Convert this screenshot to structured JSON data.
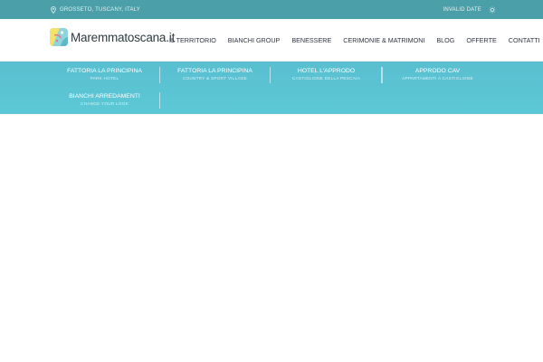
{
  "topbar": {
    "location": "GROSSETO, TUSCANY, ITALY",
    "date": "INVALID DATE"
  },
  "header": {
    "logo_text": "Maremmatoscana.it",
    "nav": [
      {
        "label": "IL TERRITORIO"
      },
      {
        "label": "BIANCHI GROUP"
      },
      {
        "label": "BENESSERE"
      },
      {
        "label": "CERIMONIE & MATRIMONI"
      },
      {
        "label": "BLOG"
      },
      {
        "label": "OFFERTE"
      },
      {
        "label": "CONTATTI"
      }
    ]
  },
  "mega_menu": {
    "items": [
      {
        "title": "FATTORIA LA PRINCIPINA",
        "subtitle": "PARK HOTEL"
      },
      {
        "title": "FATTORIA LA PRINCIPINA",
        "subtitle": "COUNTRY & SPORT VILLAGE"
      },
      {
        "title": "HOTEL L'APPRODO",
        "subtitle": "CASTIGLIONE DELLA PESCAIA"
      },
      {
        "title": "APPRODO CAV",
        "subtitle": "APPARTAMENTI A CASTIGLIONE"
      },
      {
        "title": "BIANCHI ARREDAMENTI",
        "subtitle": "CHANGE YOUR LOOK"
      }
    ]
  },
  "colors": {
    "topbar": "#4a9fa8",
    "mega_menu": "#5cc4d3",
    "nav_text": "#2d3340"
  },
  "icons": {
    "location": "map-pin-icon",
    "weather": "sun-icon",
    "search": "search-icon"
  }
}
